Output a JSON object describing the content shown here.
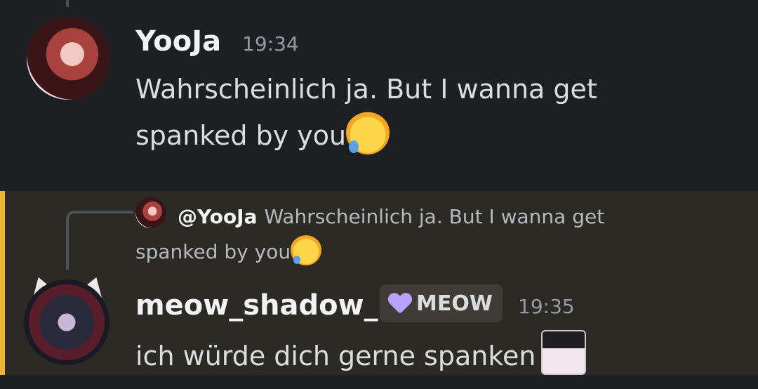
{
  "messages": [
    {
      "username": "YooJa",
      "timestamp": "19:34",
      "text": "Wahrscheinlich ja. But I wanna get spanked by you",
      "emoji": "rolling-on-floor-laughing-emoji",
      "avatar": "anime-girl-maid-avatar"
    },
    {
      "reply": {
        "mention": "@YooJa",
        "text": "Wahrscheinlich ja. But I wanna get spanked by you",
        "emoji": "rolling-on-floor-laughing-emoji"
      },
      "username": "meow_shadow_",
      "badge": "MEOW",
      "badge_icon": "purple-heart-icon",
      "timestamp": "19:35",
      "text": "ich würde dich gerne spanken",
      "sticker": "anime-sticker",
      "avatar": "anime-boy-cat-ears-avatar",
      "highlight_color": "#f0b232"
    }
  ]
}
